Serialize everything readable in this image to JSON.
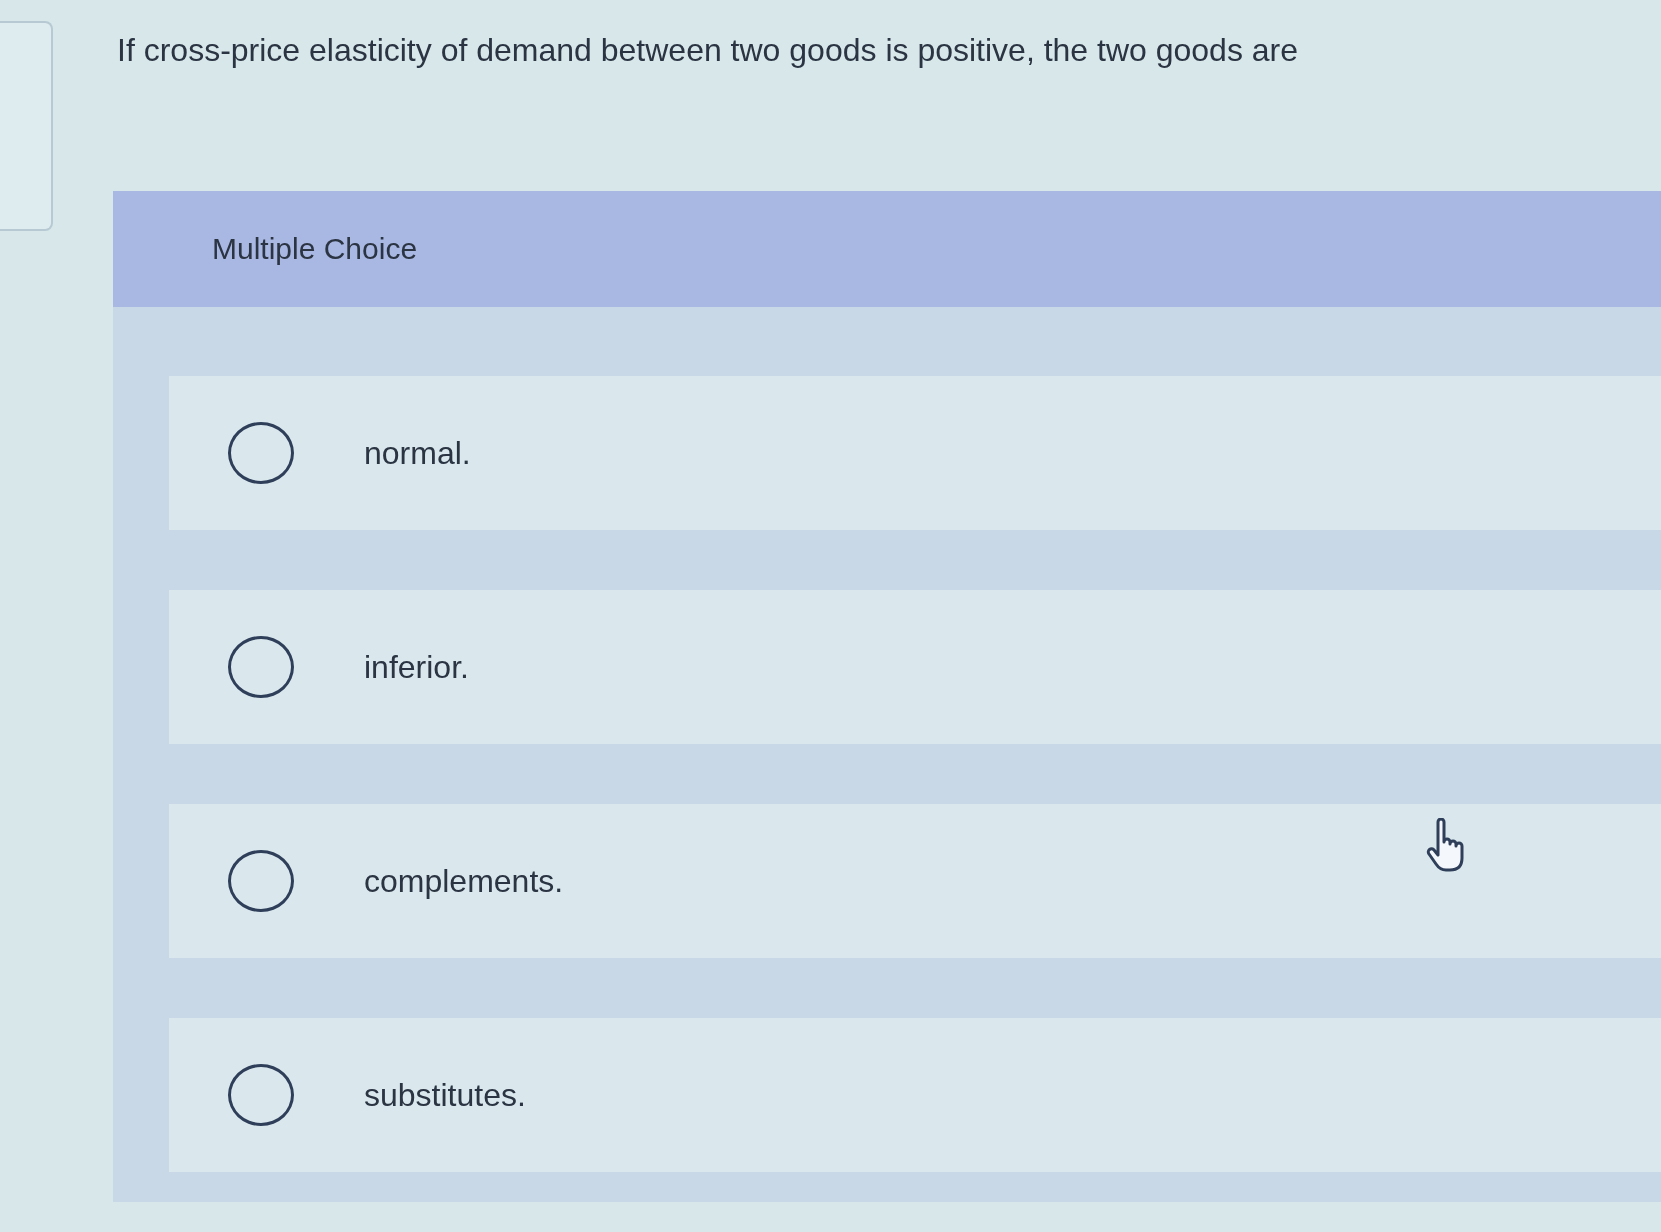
{
  "question": "If cross-price elasticity of demand between two goods is positive, the two goods are",
  "answer_panel": {
    "heading": "Multiple Choice",
    "options": [
      {
        "label": "normal.",
        "selected": false
      },
      {
        "label": "inferior.",
        "selected": false
      },
      {
        "label": "complements.",
        "selected": false
      },
      {
        "label": "substitutes.",
        "selected": false
      }
    ]
  }
}
